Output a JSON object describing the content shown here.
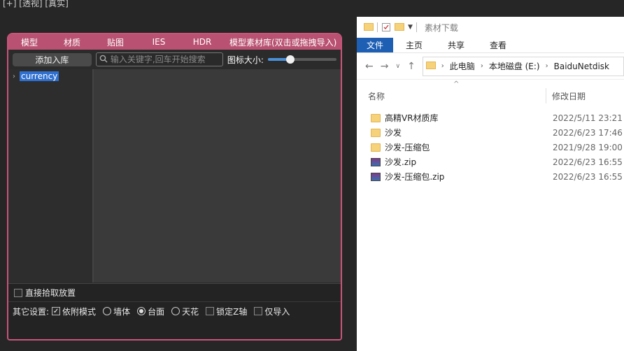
{
  "viewport": {
    "label": "[+] [透视] [真实]"
  },
  "panel": {
    "tabs": [
      "模型",
      "材质",
      "贴图",
      "IES",
      "HDR",
      "模型素材库(双击或拖拽导入)"
    ],
    "add_button": "添加入库",
    "search_placeholder": "输入关键字,回车开始搜索",
    "icon_size_label": "图标大小:",
    "icon_size_value": 0.33,
    "tree": {
      "item": "currency"
    },
    "pick_label": "直接拾取放置",
    "other_settings_label": "其它设置:",
    "options": {
      "attach_mode": "依附模式",
      "wall": "墙体",
      "table": "台面",
      "ceiling": "天花",
      "lock_z": "锁定Z轴",
      "import_only": "仅导入"
    }
  },
  "explorer": {
    "title": "素材下载",
    "ribbon": [
      "文件",
      "主页",
      "共享",
      "查看"
    ],
    "address": [
      "此电脑",
      "本地磁盘 (E:)",
      "BaiduNetdisk"
    ],
    "columns": {
      "name": "名称",
      "date": "修改日期"
    },
    "files": [
      {
        "name": "高精VR材质库",
        "date": "2022/5/11 23:21",
        "type": "folder"
      },
      {
        "name": "沙发",
        "date": "2022/6/23 17:46",
        "type": "folder"
      },
      {
        "name": "沙发-压缩包",
        "date": "2021/9/28 19:00",
        "type": "folder"
      },
      {
        "name": "沙发.zip",
        "date": "2022/6/23 16:55",
        "type": "zip"
      },
      {
        "name": "沙发-压缩包.zip",
        "date": "2022/6/23 16:55",
        "type": "zip"
      }
    ]
  },
  "colors": {
    "panel_accent": "#b95272",
    "selection": "#2f6fd0",
    "ribbon_active": "#1e5fb4"
  }
}
